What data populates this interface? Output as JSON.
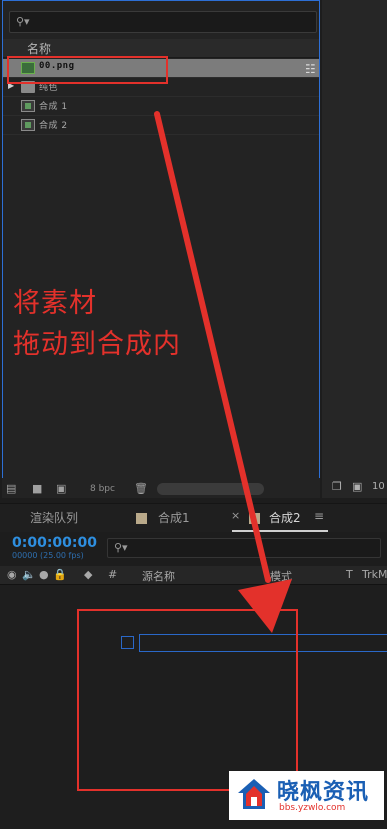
{
  "project_panel": {
    "column_name": "名称",
    "items": [
      {
        "label": "00.png",
        "selected": true,
        "type": "png"
      },
      {
        "label": "纯色",
        "type": "folder"
      },
      {
        "label": "合成 1",
        "type": "comp"
      },
      {
        "label": "合成 2",
        "type": "comp"
      }
    ],
    "footer_bpc": "8 bpc"
  },
  "right_strip": {
    "value": "10"
  },
  "instruction": {
    "line1": "将素材",
    "line2": "拖动到合成内",
    "color": "#e3312b"
  },
  "timeline": {
    "tabs": [
      "渲染队列",
      "合成1",
      "合成2"
    ],
    "active_tab": "合成2",
    "timecode": "0:00:00:00",
    "fps": "00000 (25.00 fps)",
    "headers": {
      "hash": "#",
      "source_name": "源名称",
      "mode": "模式",
      "t": "T",
      "trkmat": "TrkM"
    }
  },
  "watermark": {
    "title": "晓枫资讯",
    "url": "bbs.yzwlo.com"
  },
  "colors": {
    "accent_blue": "#2e8fe0",
    "annotation_red": "#e3312b"
  }
}
